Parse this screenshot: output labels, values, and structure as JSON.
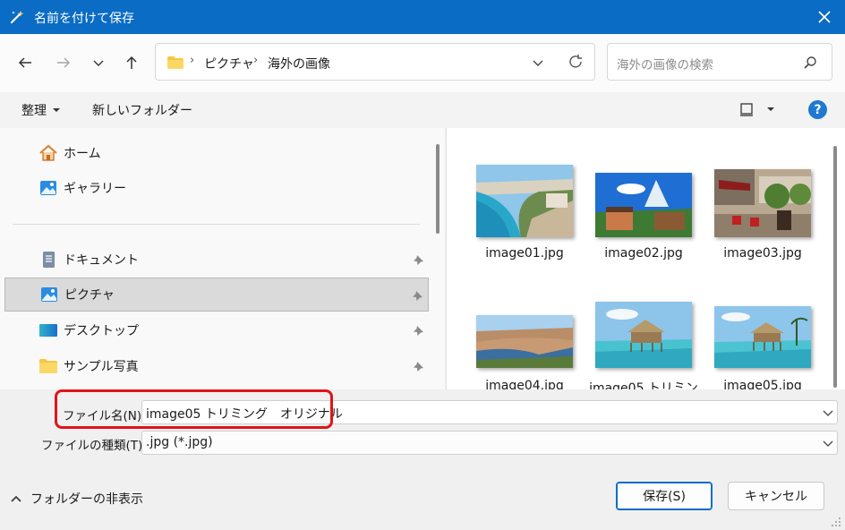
{
  "window": {
    "title": "名前を付けて保存"
  },
  "nav": {
    "back": "back",
    "forward": "forward",
    "recent": "recent",
    "up": "up"
  },
  "address": {
    "crumbs": [
      "ピクチャ",
      "海外の画像"
    ]
  },
  "search": {
    "placeholder": "海外の画像の検索"
  },
  "toolbar": {
    "organize": "整理",
    "new_folder": "新しいフォルダー"
  },
  "sidebar": {
    "items": [
      {
        "label": "ホーム",
        "icon": "home-icon"
      },
      {
        "label": "ギャラリー",
        "icon": "gallery-icon"
      },
      {
        "label": "ドキュメント",
        "icon": "document-icon",
        "pinned": true
      },
      {
        "label": "ピクチャ",
        "icon": "pictures-icon",
        "pinned": true,
        "selected": true
      },
      {
        "label": "デスクトップ",
        "icon": "desktop-icon",
        "pinned": true
      },
      {
        "label": "サンプル写真",
        "icon": "folder-icon",
        "pinned": true
      }
    ]
  },
  "files": [
    {
      "name": "image01.jpg"
    },
    {
      "name": "image02.jpg"
    },
    {
      "name": "image03.jpg"
    },
    {
      "name": "image04.jpg"
    },
    {
      "name": "image05 トリミン"
    },
    {
      "name": "image05.jpg"
    }
  ],
  "filename": {
    "label": "ファイル名(N):",
    "value": "image05 トリミング　オリジナル"
  },
  "filetype": {
    "label": "ファイルの種類(T):",
    "value": ".jpg (*.jpg)"
  },
  "footer": {
    "hide_folders": "フォルダーの非表示",
    "save": "保存(S)",
    "cancel": "キャンセル"
  },
  "colors": {
    "titlebar": "#0a6cc4",
    "highlight": "#e0141b",
    "help": "#1f78d1"
  }
}
